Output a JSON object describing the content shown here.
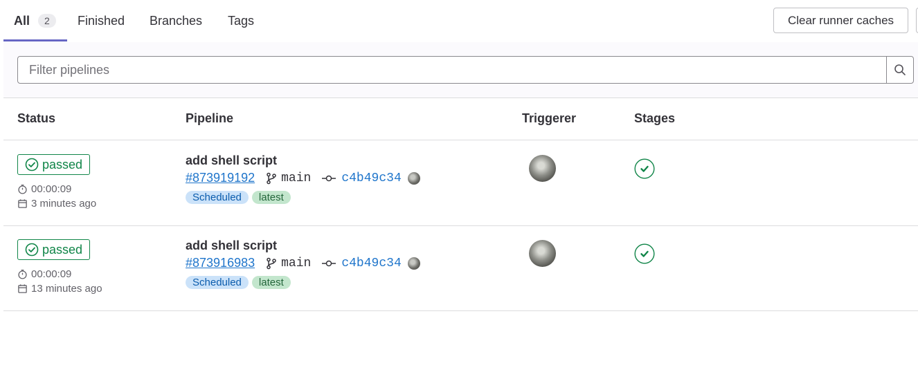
{
  "tabs": [
    {
      "label": "All",
      "count": "2",
      "active": true
    },
    {
      "label": "Finished"
    },
    {
      "label": "Branches"
    },
    {
      "label": "Tags"
    }
  ],
  "toolbar": {
    "clear_caches_label": "Clear runner caches"
  },
  "filter": {
    "placeholder": "Filter pipelines",
    "value": ""
  },
  "table": {
    "headers": {
      "status": "Status",
      "pipeline": "Pipeline",
      "triggerer": "Triggerer",
      "stages": "Stages"
    },
    "rows": [
      {
        "status": "passed",
        "duration": "00:00:09",
        "finished": "3 minutes ago",
        "title": "add shell script",
        "pipeline_id": "#873919192",
        "branch": "main",
        "commit": "c4b49c34",
        "badges": [
          "Scheduled",
          "latest"
        ],
        "stage_status": "passed"
      },
      {
        "status": "passed",
        "duration": "00:00:09",
        "finished": "13 minutes ago",
        "title": "add shell script",
        "pipeline_id": "#873916983",
        "branch": "main",
        "commit": "c4b49c34",
        "badges": [
          "Scheduled",
          "latest"
        ],
        "stage_status": "passed"
      }
    ]
  },
  "colors": {
    "success": "#108548",
    "link": "#1f75cb",
    "tab_underline": "#6666c4",
    "scheduled_bg": "#cbe2f9",
    "latest_bg": "#c3e6cd"
  },
  "icons": [
    "search-icon",
    "status-success-icon",
    "timer-icon",
    "calendar-icon",
    "branch-icon",
    "commit-icon",
    "stage-success-icon"
  ]
}
